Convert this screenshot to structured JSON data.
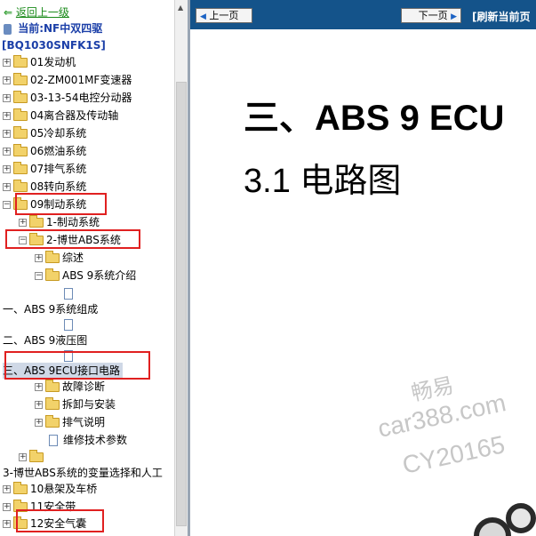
{
  "tree": {
    "back_label": "返回上一级",
    "current_label": "当前:NF中双四驱",
    "model_code": "[BQ1030SNFK1S]",
    "items": [
      {
        "label": "01发动机"
      },
      {
        "label": "02-ZM001MF变速器"
      },
      {
        "label": "03-13-54电控分动器"
      },
      {
        "label": "04离合器及传动轴"
      },
      {
        "label": "05冷却系统"
      },
      {
        "label": "06燃油系统"
      },
      {
        "label": "07排气系统"
      },
      {
        "label": "08转向系统"
      },
      {
        "label": "09制动系统"
      },
      {
        "label": "1-制动系统"
      },
      {
        "label": "2-博世ABS系统"
      },
      {
        "label": "综述"
      },
      {
        "label": "ABS 9系统介绍"
      },
      {
        "label": "一、ABS 9系统组成"
      },
      {
        "label": "二、ABS 9液压图"
      },
      {
        "label": "三、ABS 9ECU接口电路"
      },
      {
        "label": "故障诊断"
      },
      {
        "label": "拆卸与安装"
      },
      {
        "label": "排气说明"
      },
      {
        "label": "维修技术参数"
      },
      {
        "label": "3-博世ABS系统的变量选择和人工"
      },
      {
        "label": "10悬架及车桥"
      },
      {
        "label": "11安全带"
      },
      {
        "label": "12安全气囊"
      }
    ]
  },
  "toolbar": {
    "prev_label": "上一页",
    "next_label": "下一页",
    "refresh_label": "[刷新当前页"
  },
  "content": {
    "heading_1": "三、ABS 9 ECU",
    "heading_2": "3.1  电路图"
  },
  "watermark": {
    "line1": "畅易",
    "line2": "car388.com",
    "line3": "CY20165"
  },
  "colors": {
    "nav_bar": "#14538a",
    "highlight_box": "#e02020",
    "selected_row": "#cfd8e6"
  }
}
